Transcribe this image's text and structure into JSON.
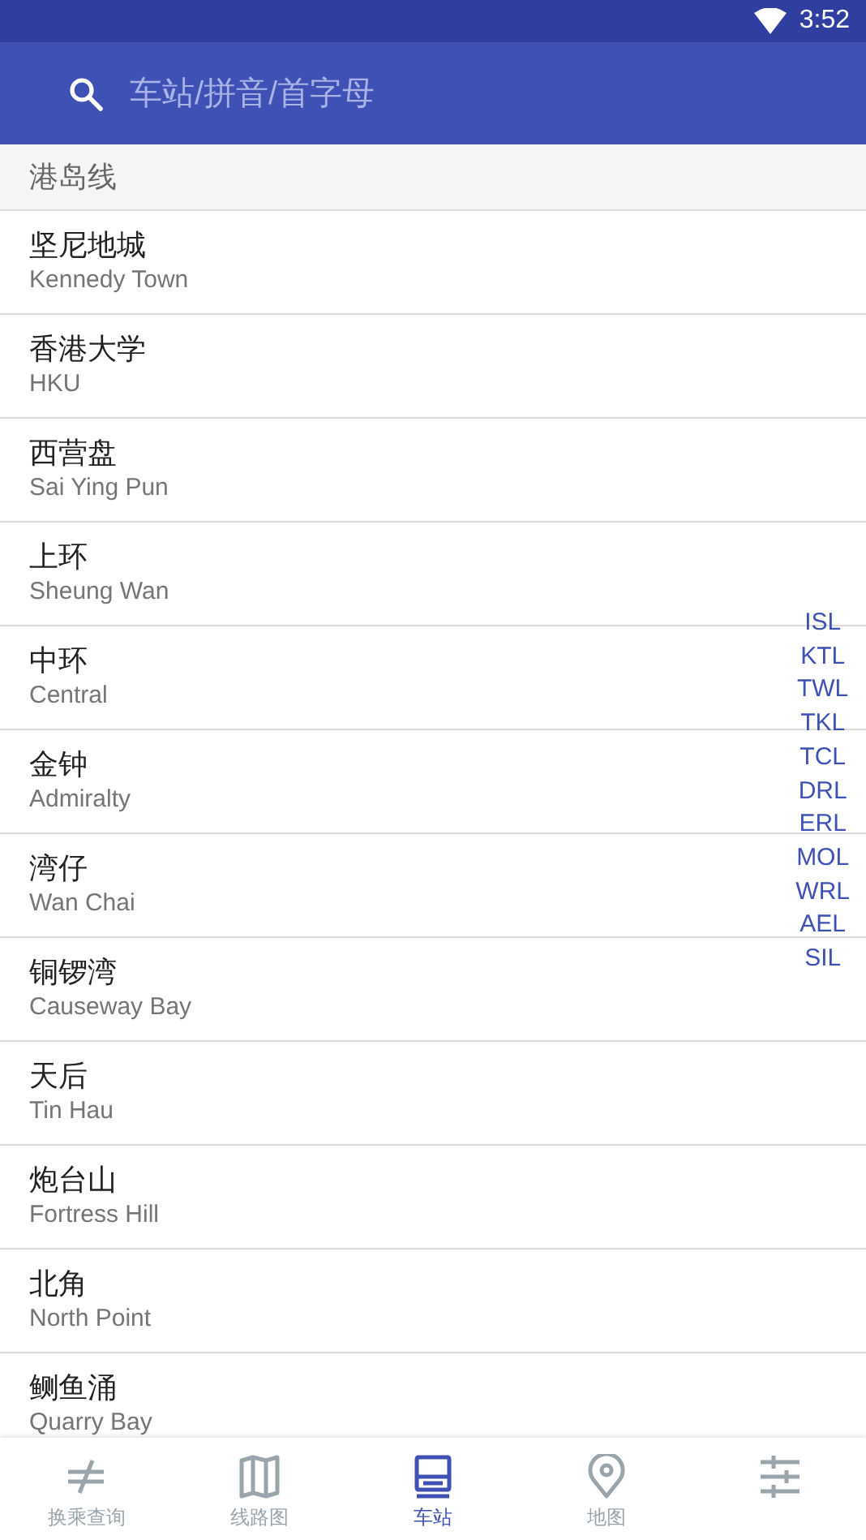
{
  "status_bar": {
    "time": "3:52"
  },
  "search": {
    "placeholder": "车站/拼音/首字母"
  },
  "section": {
    "title": "港岛线"
  },
  "stations": [
    {
      "name": "坚尼地城",
      "english": "Kennedy Town"
    },
    {
      "name": "香港大学",
      "english": "HKU"
    },
    {
      "name": "西营盘",
      "english": "Sai Ying Pun"
    },
    {
      "name": "上环",
      "english": "Sheung Wan"
    },
    {
      "name": "中环",
      "english": "Central"
    },
    {
      "name": "金钟",
      "english": "Admiralty"
    },
    {
      "name": "湾仔",
      "english": "Wan Chai"
    },
    {
      "name": "铜锣湾",
      "english": "Causeway Bay"
    },
    {
      "name": "天后",
      "english": "Tin Hau"
    },
    {
      "name": "炮台山",
      "english": "Fortress Hill"
    },
    {
      "name": "北角",
      "english": "North Point"
    },
    {
      "name": "鲗鱼涌",
      "english": "Quarry Bay"
    }
  ],
  "line_index": [
    "ISL",
    "KTL",
    "TWL",
    "TKL",
    "TCL",
    "DRL",
    "ERL",
    "MOL",
    "WRL",
    "AEL",
    "SIL"
  ],
  "bottom_nav": [
    {
      "kind": "transfer",
      "label": "换乘查询",
      "selected": false
    },
    {
      "kind": "map",
      "label": "线路图",
      "selected": false
    },
    {
      "kind": "station",
      "label": "车站",
      "selected": true
    },
    {
      "kind": "pin",
      "label": "地图",
      "selected": false
    },
    {
      "kind": "settings",
      "selected": false
    }
  ]
}
